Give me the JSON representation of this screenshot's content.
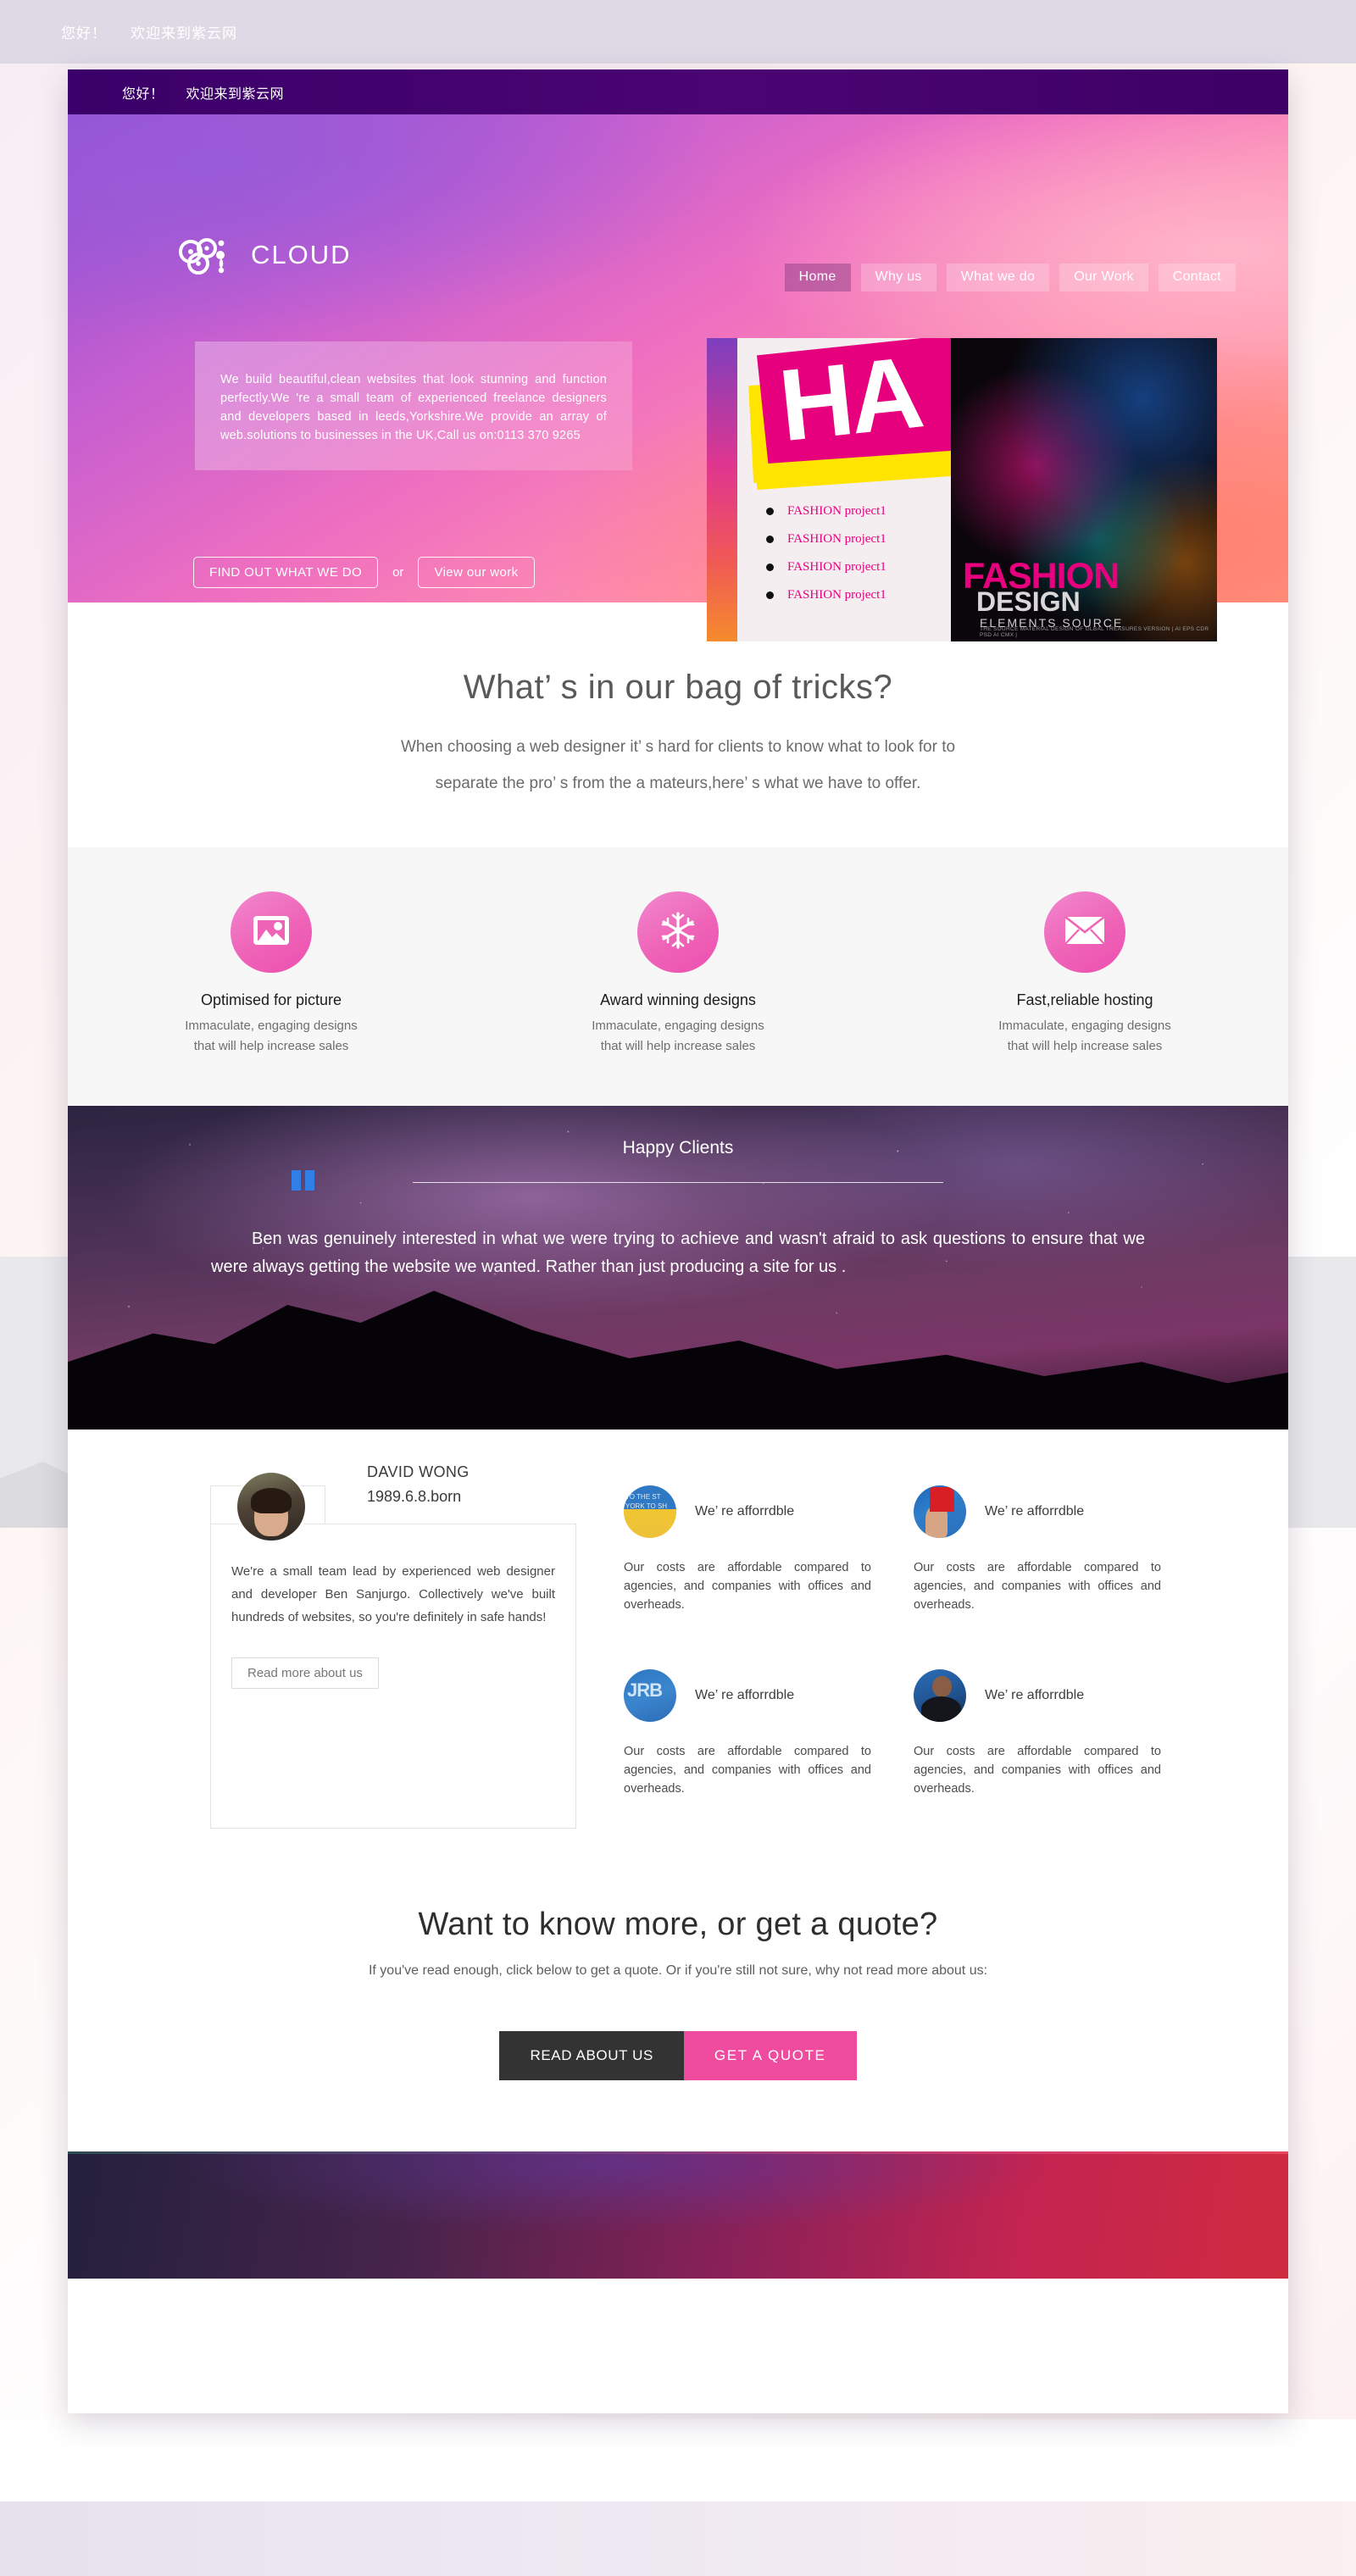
{
  "outer_topbar": {
    "hello": "您好！",
    "welcome": "欢迎来到紫云网"
  },
  "site_topbar": {
    "hello": "您好！",
    "welcome": "欢迎来到紫云网"
  },
  "brand": {
    "name": "CLOUD",
    "logo_icon": "cloud-swirl-logo"
  },
  "nav": {
    "items": [
      {
        "label": "Home",
        "active": true
      },
      {
        "label": "Why us",
        "active": false
      },
      {
        "label": "What we do",
        "active": false
      },
      {
        "label": "Our Work",
        "active": false
      },
      {
        "label": "Contact",
        "active": false
      }
    ]
  },
  "hero": {
    "blurb": "We build beautiful,clean websites that look stunning and function perfectly.We 're a small team of experienced freelance designers and developers based in leeds,Yorkshire.We provide an array of web.solutions to businesses in the UK,Call us on:0113 370 9265",
    "primary_button": "FIND OUT WHAT WE DO",
    "separator": "or",
    "secondary_button": "View our work",
    "artwork": {
      "headline": "HA",
      "project_items": [
        "FASHION project1",
        "FASHION project1",
        "FASHION project1",
        "FASHION project1"
      ],
      "poster_title": "FASHION",
      "poster_subtitle": "DESIGN",
      "poster_tagline": "ELEMENTS  SOURCE",
      "poster_fineprint": "THE SOURCE MATERIAL DESIGN OF GLBAL TREASURES VERSION | AI EPS CDR PSD AI CMX |"
    }
  },
  "tricks": {
    "heading": "What’ s in our bag of tricks?",
    "line1": "When choosing a web designer it’ s hard for clients to know what to look for to",
    "line2": "separate the pro’ s from the a mateurs,here’ s what we have to offer."
  },
  "features": [
    {
      "icon": "image-picture-icon",
      "title": "Optimised for picture",
      "desc_line1": "Immaculate, engaging designs",
      "desc_line2": "that will help increase sales"
    },
    {
      "icon": "snowflake-icon",
      "title": "Award winning designs",
      "desc_line1": "Immaculate, engaging designs",
      "desc_line2": "that will help increase sales"
    },
    {
      "icon": "envelope-mail-icon",
      "title": "Fast,reliable hosting",
      "desc_line1": "Immaculate, engaging designs",
      "desc_line2": "that will help increase sales"
    }
  ],
  "testimonial": {
    "heading": "Happy Clients",
    "quote_icon": "quotation-mark-icon",
    "quote": "Ben was genuinely interested in what we were trying to achieve and wasn't afraid to ask questions to ensure that we were always getting the website we wanted. Rather than just producing a site for us ."
  },
  "about": {
    "profile": {
      "avatar_icon": "user-photo-avatar",
      "name": "DAVID WONG",
      "born": "1989.6.8.born",
      "bio": "We're a small team lead by experienced web designer and developer Ben Sanjurgo. Collectively we've built hundreds of websites, so you're definitely in safe hands!",
      "read_more_button": "Read more about us"
    },
    "grid_items": [
      {
        "avatar_icon": "flag-banner-photo",
        "tag": "We’ re afforrdble",
        "desc": "Our costs are affordable compared to agencies, and companies with offices and overheads."
      },
      {
        "avatar_icon": "person-red-sleeve-photo",
        "tag": "We’ re afforrdble",
        "desc": "Our costs are affordable compared to agencies, and companies with offices and overheads."
      },
      {
        "avatar_icon": "jrb-graffiti-photo",
        "tag": "We’ re afforrdble",
        "desc": "Our costs are affordable compared to agencies, and companies with offices and overheads."
      },
      {
        "avatar_icon": "woman-portrait-photo",
        "tag": "We’ re afforrdble",
        "desc": "Our costs are affordable compared to agencies, and companies with offices and overheads."
      }
    ]
  },
  "cta": {
    "heading": "Want to know more, or get a quote?",
    "subtext": "If you've read enough, click below to get a quote. Or if you're still not sure, why not read more about us:",
    "read_button": "READ ABOUT US",
    "quote_button": "GET A QUOTE"
  },
  "colors": {
    "purple_bar": "#3d0066",
    "pink_accent": "#ef4ca0",
    "dark_button": "#333333",
    "feature_circle": "#ef63b7",
    "quote_blue": "#2f7fe6"
  }
}
